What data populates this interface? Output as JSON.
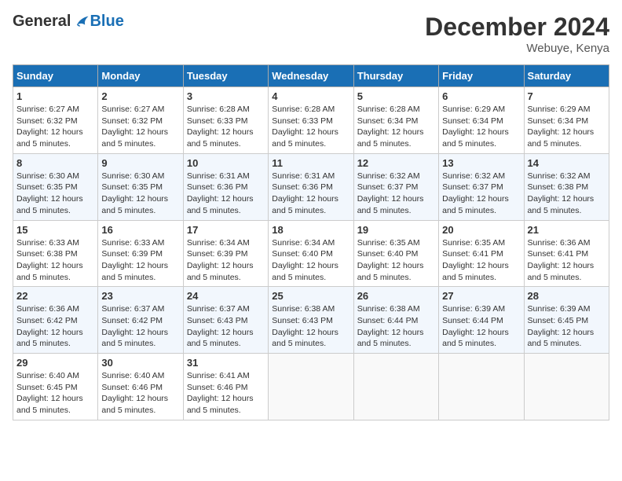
{
  "header": {
    "logo_general": "General",
    "logo_blue": "Blue",
    "month_title": "December 2024",
    "location": "Webuye, Kenya"
  },
  "calendar": {
    "days_of_week": [
      "Sunday",
      "Monday",
      "Tuesday",
      "Wednesday",
      "Thursday",
      "Friday",
      "Saturday"
    ],
    "weeks": [
      [
        {
          "day": "1",
          "sunrise": "6:27 AM",
          "sunset": "6:32 PM",
          "daylight": "12 hours and 5 minutes."
        },
        {
          "day": "2",
          "sunrise": "6:27 AM",
          "sunset": "6:32 PM",
          "daylight": "12 hours and 5 minutes."
        },
        {
          "day": "3",
          "sunrise": "6:28 AM",
          "sunset": "6:33 PM",
          "daylight": "12 hours and 5 minutes."
        },
        {
          "day": "4",
          "sunrise": "6:28 AM",
          "sunset": "6:33 PM",
          "daylight": "12 hours and 5 minutes."
        },
        {
          "day": "5",
          "sunrise": "6:28 AM",
          "sunset": "6:34 PM",
          "daylight": "12 hours and 5 minutes."
        },
        {
          "day": "6",
          "sunrise": "6:29 AM",
          "sunset": "6:34 PM",
          "daylight": "12 hours and 5 minutes."
        },
        {
          "day": "7",
          "sunrise": "6:29 AM",
          "sunset": "6:34 PM",
          "daylight": "12 hours and 5 minutes."
        }
      ],
      [
        {
          "day": "8",
          "sunrise": "6:30 AM",
          "sunset": "6:35 PM",
          "daylight": "12 hours and 5 minutes."
        },
        {
          "day": "9",
          "sunrise": "6:30 AM",
          "sunset": "6:35 PM",
          "daylight": "12 hours and 5 minutes."
        },
        {
          "day": "10",
          "sunrise": "6:31 AM",
          "sunset": "6:36 PM",
          "daylight": "12 hours and 5 minutes."
        },
        {
          "day": "11",
          "sunrise": "6:31 AM",
          "sunset": "6:36 PM",
          "daylight": "12 hours and 5 minutes."
        },
        {
          "day": "12",
          "sunrise": "6:32 AM",
          "sunset": "6:37 PM",
          "daylight": "12 hours and 5 minutes."
        },
        {
          "day": "13",
          "sunrise": "6:32 AM",
          "sunset": "6:37 PM",
          "daylight": "12 hours and 5 minutes."
        },
        {
          "day": "14",
          "sunrise": "6:32 AM",
          "sunset": "6:38 PM",
          "daylight": "12 hours and 5 minutes."
        }
      ],
      [
        {
          "day": "15",
          "sunrise": "6:33 AM",
          "sunset": "6:38 PM",
          "daylight": "12 hours and 5 minutes."
        },
        {
          "day": "16",
          "sunrise": "6:33 AM",
          "sunset": "6:39 PM",
          "daylight": "12 hours and 5 minutes."
        },
        {
          "day": "17",
          "sunrise": "6:34 AM",
          "sunset": "6:39 PM",
          "daylight": "12 hours and 5 minutes."
        },
        {
          "day": "18",
          "sunrise": "6:34 AM",
          "sunset": "6:40 PM",
          "daylight": "12 hours and 5 minutes."
        },
        {
          "day": "19",
          "sunrise": "6:35 AM",
          "sunset": "6:40 PM",
          "daylight": "12 hours and 5 minutes."
        },
        {
          "day": "20",
          "sunrise": "6:35 AM",
          "sunset": "6:41 PM",
          "daylight": "12 hours and 5 minutes."
        },
        {
          "day": "21",
          "sunrise": "6:36 AM",
          "sunset": "6:41 PM",
          "daylight": "12 hours and 5 minutes."
        }
      ],
      [
        {
          "day": "22",
          "sunrise": "6:36 AM",
          "sunset": "6:42 PM",
          "daylight": "12 hours and 5 minutes."
        },
        {
          "day": "23",
          "sunrise": "6:37 AM",
          "sunset": "6:42 PM",
          "daylight": "12 hours and 5 minutes."
        },
        {
          "day": "24",
          "sunrise": "6:37 AM",
          "sunset": "6:43 PM",
          "daylight": "12 hours and 5 minutes."
        },
        {
          "day": "25",
          "sunrise": "6:38 AM",
          "sunset": "6:43 PM",
          "daylight": "12 hours and 5 minutes."
        },
        {
          "day": "26",
          "sunrise": "6:38 AM",
          "sunset": "6:44 PM",
          "daylight": "12 hours and 5 minutes."
        },
        {
          "day": "27",
          "sunrise": "6:39 AM",
          "sunset": "6:44 PM",
          "daylight": "12 hours and 5 minutes."
        },
        {
          "day": "28",
          "sunrise": "6:39 AM",
          "sunset": "6:45 PM",
          "daylight": "12 hours and 5 minutes."
        }
      ],
      [
        {
          "day": "29",
          "sunrise": "6:40 AM",
          "sunset": "6:45 PM",
          "daylight": "12 hours and 5 minutes."
        },
        {
          "day": "30",
          "sunrise": "6:40 AM",
          "sunset": "6:46 PM",
          "daylight": "12 hours and 5 minutes."
        },
        {
          "day": "31",
          "sunrise": "6:41 AM",
          "sunset": "6:46 PM",
          "daylight": "12 hours and 5 minutes."
        },
        null,
        null,
        null,
        null
      ]
    ]
  }
}
